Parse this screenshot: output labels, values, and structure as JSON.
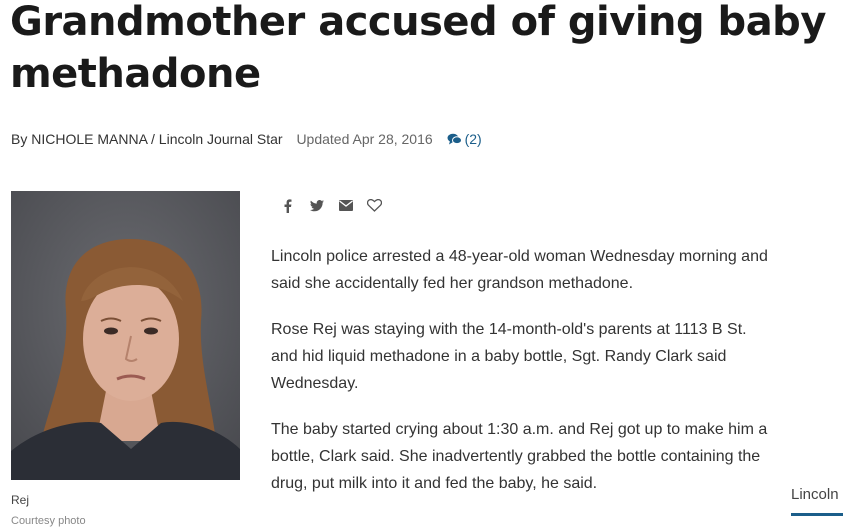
{
  "headline": {
    "line1": "Grandmother accused of giving baby",
    "line2": "methadone"
  },
  "byline": {
    "author": "By NICHOLE MANNA / Lincoln Journal Star",
    "updated": "Updated Apr 28, 2016",
    "comments": "(2)",
    "comments_icon": "comments-icon"
  },
  "photo": {
    "caption": "Rej",
    "credit": "Courtesy photo"
  },
  "share_icons": [
    "facebook-icon",
    "twitter-icon",
    "email-icon",
    "heart-icon"
  ],
  "article": {
    "paragraphs": [
      "Lincoln police arrested a 48-year-old woman Wednesday morning and said she accidentally fed her grandson methadone.",
      "Rose Rej was staying with the 14-month-old's parents at 1113 B St. and hid liquid methadone in a baby bottle, Sgt. Randy Clark said Wednesday.",
      "The baby started crying about 1:30 a.m. and Rej got up to make him a bottle, Clark said. She inadvertently grabbed the bottle containing the drug, put milk into it and fed the baby, he said."
    ]
  },
  "sidebar": {
    "link": "Lincoln"
  },
  "colors": {
    "accent": "#1b5e8a",
    "headline": "#1a1a1a",
    "body_text": "#333333"
  }
}
